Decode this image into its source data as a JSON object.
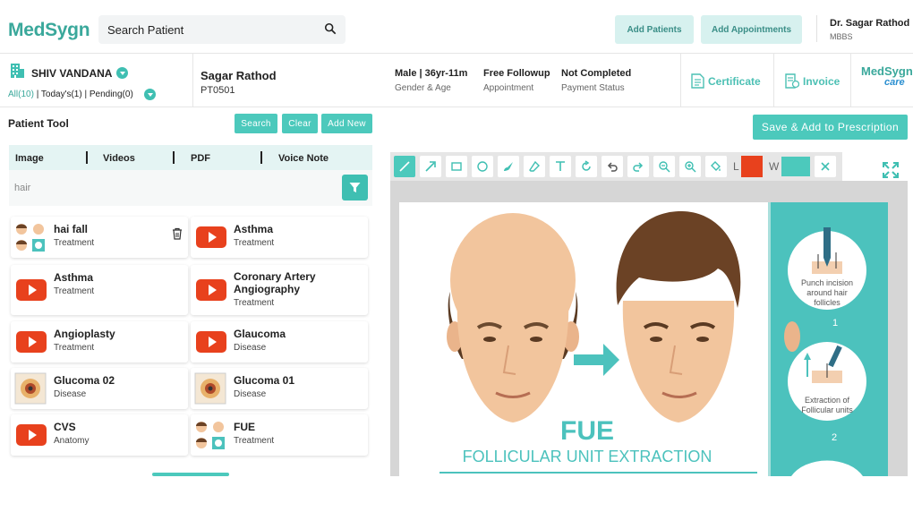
{
  "header": {
    "logo": "MedSygn",
    "search_placeholder": "Search Patient",
    "add_patients": "Add Patients",
    "add_appointments": "Add Appointments",
    "doctor_name": "Dr. Sagar Rathod",
    "doctor_degree": "MBBS"
  },
  "clinic": {
    "name": "SHIV VANDANA",
    "filter_all": "All(10)",
    "filter_today": "| Today's(1) |",
    "filter_pending": "Pending(0)"
  },
  "patient": {
    "name": "Sagar Rathod",
    "id": "PT0501",
    "stats": [
      {
        "value": "Male | 36yr-11m",
        "label": "Gender & Age"
      },
      {
        "value": "Free Followup",
        "label": "Appointment"
      },
      {
        "value": "Not Completed",
        "label": "Payment Status"
      }
    ],
    "certificate": "Certificate",
    "invoice": "Invoice",
    "brand_top": "MedSygn",
    "brand_bottom": "care"
  },
  "tool_panel": {
    "title": "Patient Tool",
    "search": "Search",
    "clear": "Clear",
    "add_new": "Add New",
    "tabs": [
      "Image",
      "Videos",
      "PDF",
      "Voice Note"
    ],
    "filter_value": "hair",
    "items": [
      {
        "title": "hai fall",
        "sub": "Treatment",
        "media": "thumb-hair"
      },
      {
        "title": "Asthma",
        "sub": "Treatment",
        "media": "video"
      },
      {
        "title": "Asthma",
        "sub": "Treatment",
        "media": "video"
      },
      {
        "title": "Coronary Artery Angiography",
        "sub": "Treatment",
        "media": "video"
      },
      {
        "title": "Angioplasty",
        "sub": "Treatment",
        "media": "video"
      },
      {
        "title": "Glaucoma",
        "sub": "Disease",
        "media": "video"
      },
      {
        "title": "Glucoma 02",
        "sub": "Disease",
        "media": "thumb-eye"
      },
      {
        "title": "Glucoma 01",
        "sub": "Disease",
        "media": "thumb-eye"
      },
      {
        "title": "CVS",
        "sub": "Anatomy",
        "media": "video"
      },
      {
        "title": "FUE",
        "sub": "Treatment",
        "media": "thumb-hair"
      }
    ]
  },
  "editor": {
    "save_label": "Save & Add to Prescription",
    "label_l": "L",
    "label_w": "W",
    "colors": {
      "line": "#e8411d",
      "width": "#4cc9bc",
      "accent": "#4cc9bc"
    },
    "image": {
      "title": "FUE",
      "subtitle": "FOLLICULAR UNIT EXTRACTION",
      "step1": [
        "Punch incision",
        "around hair",
        "follicles"
      ],
      "step1_num": "1",
      "step2": [
        "Extraction of",
        "Follicular units"
      ],
      "step2_num": "2"
    }
  }
}
